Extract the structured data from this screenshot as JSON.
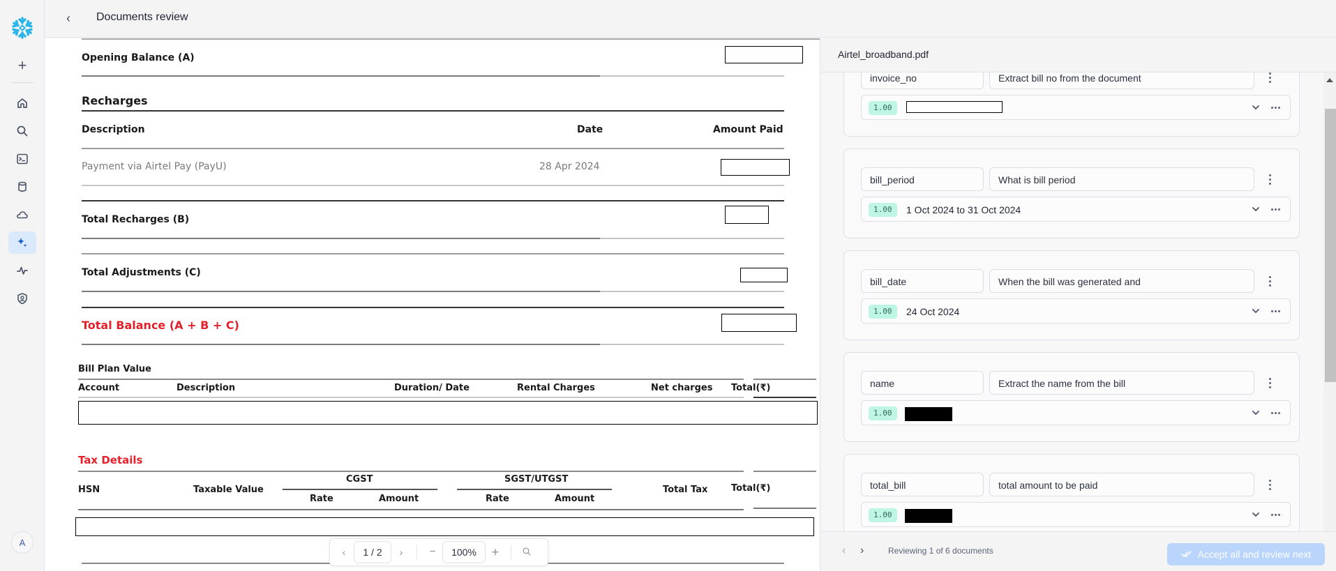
{
  "app": {
    "title": "Documents review",
    "accent_color": "#29b5e8",
    "active_nav_color": "#dbe9fd"
  },
  "rail": {
    "items": [
      {
        "name": "create",
        "icon": "plus-icon"
      },
      {
        "name": "home",
        "icon": "home-icon"
      },
      {
        "name": "search",
        "icon": "search-icon"
      },
      {
        "name": "worksheets",
        "icon": "terminal-icon"
      },
      {
        "name": "data",
        "icon": "database-icon"
      },
      {
        "name": "data-products",
        "icon": "cloud-icon"
      },
      {
        "name": "ai-ml",
        "icon": "sparkle-icon",
        "active": true
      },
      {
        "name": "monitoring",
        "icon": "activity-icon"
      },
      {
        "name": "admin",
        "icon": "shield-user-icon"
      }
    ],
    "avatar_initial": "A"
  },
  "document": {
    "opening_balance_label": "Opening Balance (A)",
    "recharges_heading": "Recharges",
    "recharges_columns": [
      "Description",
      "Date",
      "Amount Paid"
    ],
    "recharges_rows": [
      {
        "description": "Payment via Airtel Pay (PayU)",
        "date": "28 Apr 2024",
        "amount": ""
      }
    ],
    "total_recharges_label": "Total Recharges (B)",
    "total_adjustments_label": "Total Adjustments (C)",
    "total_balance_label": "Total Balance (A + B + C)",
    "bill_plan_heading": "Bill Plan Value",
    "bill_plan_columns": [
      "Account",
      "Description",
      "Duration/ Date",
      "Rental Charges",
      "Net charges",
      "Total(₹)"
    ],
    "tax_heading": "Tax Details",
    "tax_columns": {
      "hsn": "HSN",
      "taxable_value": "Taxable Value",
      "cgst": "CGST",
      "sgst": "SGST/UTGST",
      "rate": "Rate",
      "amount": "Amount",
      "total_tax": "Total Tax",
      "total": "Total(₹)"
    }
  },
  "pager": {
    "page": "1 / 2",
    "zoom": "100%",
    "prev_icon": "chevron-left-icon",
    "next_icon": "chevron-right-icon",
    "zoom_out_icon": "minus-icon",
    "zoom_in_icon": "plus-icon",
    "search_icon": "search-icon"
  },
  "panel": {
    "file_name": "Airtel_broadband.pdf",
    "fields": [
      {
        "key": "invoice_no",
        "prompt": "Extract bill no from the document",
        "score": "1.00",
        "value": "",
        "redacted": "outline"
      },
      {
        "key": "bill_period",
        "prompt": "What is bill period",
        "score": "1.00",
        "value": "1 Oct 2024 to 31 Oct 2024"
      },
      {
        "key": "bill_date",
        "prompt": "When the bill was generated and",
        "score": "1.00",
        "value": "24 Oct 2024"
      },
      {
        "key": "name",
        "prompt": "Extract the name from the bill",
        "score": "1.00",
        "value": "",
        "redacted": "fill"
      },
      {
        "key": "total_bill",
        "prompt": "total amount to be paid",
        "score": "1.00",
        "value": "",
        "redacted": "fill"
      }
    ],
    "footer": {
      "status": "Reviewing 1 of 6 documents",
      "accept_label": "Accept all and review next"
    }
  }
}
